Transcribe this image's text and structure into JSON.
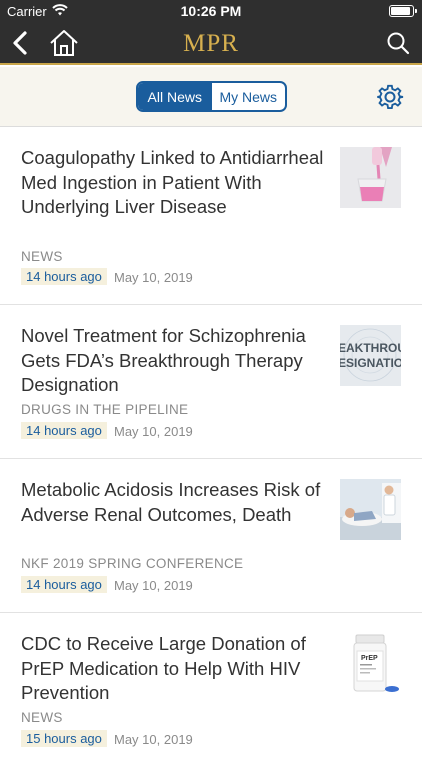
{
  "status_bar": {
    "carrier": "Carrier",
    "time": "10:26 PM",
    "battery_level": 0.95
  },
  "nav": {
    "brand": "MPR"
  },
  "segment": {
    "all_news": "All News",
    "my_news": "My News",
    "selected": "All News"
  },
  "news": [
    {
      "title": "Coagulopathy Linked to Antidiarrheal Med Ingestion in Patient With Underlying Liver Disease",
      "category": "NEWS",
      "time_ago": "14 hours ago",
      "date": "May 10, 2019",
      "thumb_icon": "pink-medicine-pour-image"
    },
    {
      "title": "Novel Treatment for Schizophrenia Gets FDA’s Breakthrough Therapy Designation",
      "category": "DRUGS IN THE PIPELINE",
      "time_ago": "14 hours ago",
      "date": "May 10, 2019",
      "thumb_icon": "breakthrough-designation-image",
      "thumb_text_1": "EAKTHROU",
      "thumb_text_2": "ESIGNATIO"
    },
    {
      "title": "Metabolic Acidosis Increases Risk of Adverse Renal Outcomes, Death",
      "category": "NKF 2019 SPRING CONFERENCE",
      "time_ago": "14 hours ago",
      "date": "May 10, 2019",
      "thumb_icon": "doctor-patient-image"
    },
    {
      "title": "CDC to Receive Large Donation of PrEP Medication to Help With HIV Prevention",
      "category": "NEWS",
      "time_ago": "15 hours ago",
      "date": "May 10, 2019",
      "thumb_icon": "prep-bottle-image",
      "thumb_label": "PrEP"
    }
  ],
  "colors": {
    "header": "#2f2f2f",
    "brand_gold": "#d7b04f",
    "accent_blue": "#1a5d9d"
  }
}
